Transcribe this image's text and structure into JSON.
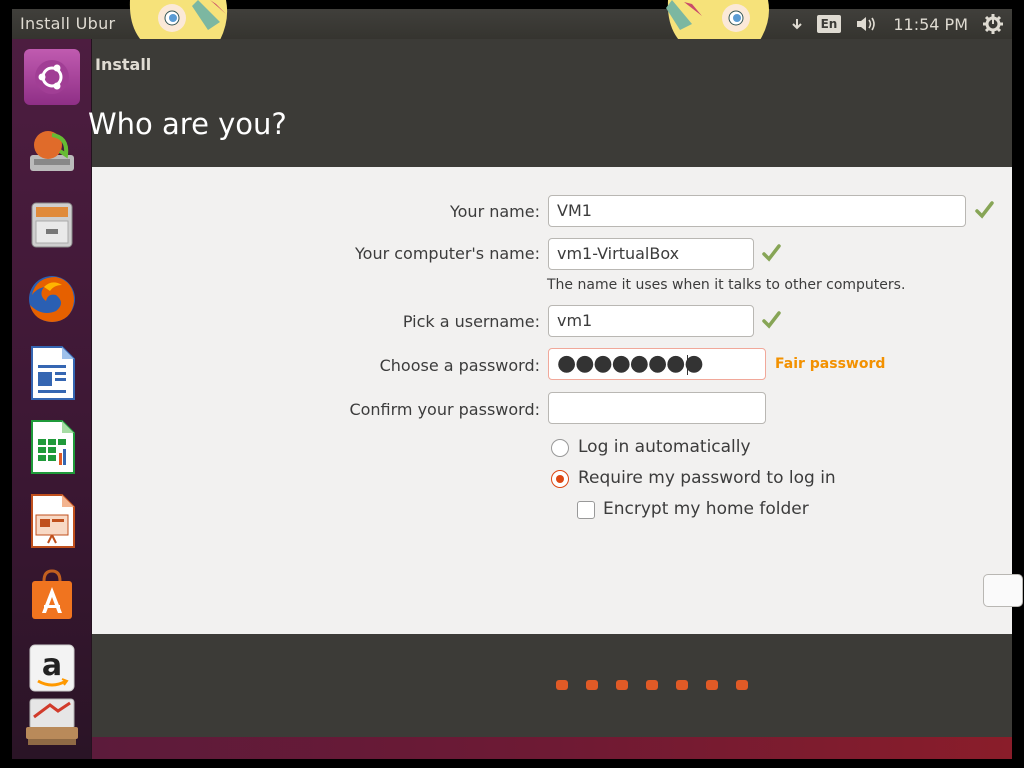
{
  "top_panel": {
    "title": "Install Ubur",
    "keyboard_layout": "En",
    "clock": "11:54 PM",
    "icons": [
      "network-arrow-icon",
      "volume-icon",
      "gear-icon"
    ]
  },
  "launcher": {
    "items": [
      {
        "name": "ubuntu-dash",
        "icon": "ubuntu-logo-icon"
      },
      {
        "name": "installer",
        "icon": "installer-icon"
      },
      {
        "name": "files",
        "icon": "file-cabinet-icon"
      },
      {
        "name": "firefox",
        "icon": "firefox-icon"
      },
      {
        "name": "writer",
        "icon": "libreoffice-writer-icon"
      },
      {
        "name": "calc",
        "icon": "libreoffice-calc-icon"
      },
      {
        "name": "impress",
        "icon": "libreoffice-impress-icon"
      },
      {
        "name": "software-center",
        "icon": "shopping-bag-icon"
      },
      {
        "name": "amazon",
        "icon": "amazon-icon"
      },
      {
        "name": "trash-stack",
        "icon": "stack-icon"
      }
    ]
  },
  "window": {
    "title": "Install",
    "heading": "Who are you?"
  },
  "form": {
    "name_label": "Your name:",
    "name_value": "VM1",
    "computer_label": "Your computer's name:",
    "computer_value": "vm1-VirtualBox",
    "computer_hint": "The name it uses when it talks to other computers.",
    "username_label": "Pick a username:",
    "username_value": "vm1",
    "password_label": "Choose a password:",
    "password_value": "●●●●●●●●",
    "password_strength": "Fair password",
    "confirm_label": "Confirm your password:",
    "confirm_value": "",
    "login_auto_label": "Log in automatically",
    "require_password_label": "Require my password to log in",
    "encrypt_home_label": "Encrypt my home folder"
  },
  "colors": {
    "accent": "#dd4814",
    "check_green": "#87a556",
    "warning_orange": "#f39100"
  },
  "progress": {
    "total_steps": 7
  }
}
